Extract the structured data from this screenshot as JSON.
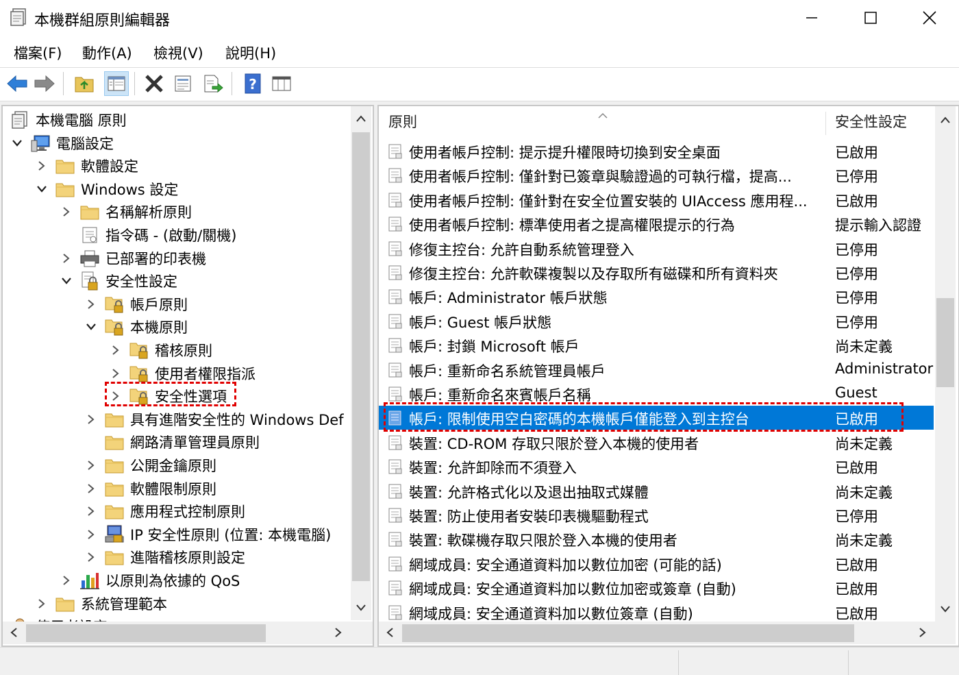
{
  "window": {
    "title": "本機群組原則編輯器"
  },
  "menu": [
    "檔案(F)",
    "動作(A)",
    "檢視(V)",
    "說明(H)"
  ],
  "toolbar": [
    "back-arrow-icon",
    "forward-arrow-icon",
    "up-folder-icon",
    "show-hide-tree-icon",
    "delete-icon",
    "properties-icon",
    "export-list-icon",
    "help-icon",
    "console-view-icon"
  ],
  "tree": [
    {
      "label": "本機電腦 原則",
      "level": 0,
      "chevron": "none",
      "icon": "policy-doc-icon"
    },
    {
      "label": "電腦設定",
      "level": 0,
      "chevron": "down",
      "icon": "computer-icon"
    },
    {
      "label": "軟體設定",
      "level": 1,
      "chevron": "right",
      "icon": "folder-icon"
    },
    {
      "label": "Windows 設定",
      "level": 1,
      "chevron": "down",
      "icon": "folder-icon"
    },
    {
      "label": "名稱解析原則",
      "level": 2,
      "chevron": "right",
      "icon": "folder-icon"
    },
    {
      "label": "指令碼 - (啟動/關機)",
      "level": 2,
      "chevron": "none",
      "icon": "script-icon"
    },
    {
      "label": "已部署的印表機",
      "level": 2,
      "chevron": "right",
      "icon": "printer-icon"
    },
    {
      "label": "安全性設定",
      "level": 2,
      "chevron": "down",
      "icon": "security-settings-icon"
    },
    {
      "label": "帳戶原則",
      "level": 3,
      "chevron": "right",
      "icon": "lock-folder-icon"
    },
    {
      "label": "本機原則",
      "level": 3,
      "chevron": "down",
      "icon": "lock-folder-icon"
    },
    {
      "label": "稽核原則",
      "level": 4,
      "chevron": "right",
      "icon": "lock-folder-icon"
    },
    {
      "label": "使用者權限指派",
      "level": 4,
      "chevron": "right",
      "icon": "lock-folder-icon"
    },
    {
      "label": "安全性選項",
      "level": 4,
      "chevron": "right",
      "icon": "lock-folder-icon"
    },
    {
      "label": "具有進階安全性的 Windows Def",
      "level": 3,
      "chevron": "right",
      "icon": "folder-icon"
    },
    {
      "label": "網路清單管理員原則",
      "level": 3,
      "chevron": "none",
      "icon": "folder-icon"
    },
    {
      "label": "公開金鑰原則",
      "level": 3,
      "chevron": "right",
      "icon": "folder-icon"
    },
    {
      "label": "軟體限制原則",
      "level": 3,
      "chevron": "right",
      "icon": "folder-icon"
    },
    {
      "label": "應用程式控制原則",
      "level": 3,
      "chevron": "right",
      "icon": "folder-icon"
    },
    {
      "label": "IP 安全性原則 (位置: 本機電腦)",
      "level": 3,
      "chevron": "right",
      "icon": "ip-security-icon"
    },
    {
      "label": "進階稽核原則設定",
      "level": 3,
      "chevron": "right",
      "icon": "folder-icon"
    },
    {
      "label": "以原則為依據的 QoS",
      "level": 2,
      "chevron": "right",
      "icon": "qos-chart-icon"
    },
    {
      "label": "系統管理範本",
      "level": 1,
      "chevron": "right",
      "icon": "folder-icon"
    },
    {
      "label": "使用者設定",
      "level": 0,
      "chevron": "none",
      "icon": "user-icon"
    }
  ],
  "list": {
    "col_policy": "原則",
    "col_setting": "安全性設定",
    "rows": [
      {
        "name": "使用者帳戶控制: 提示提升權限時切換到安全桌面",
        "value": "已啟用"
      },
      {
        "name": "使用者帳戶控制: 僅針對已簽章與驗證過的可執行檔，提高...",
        "value": "已停用"
      },
      {
        "name": "使用者帳戶控制: 僅針對在安全位置安裝的 UIAccess 應用程...",
        "value": "已啟用"
      },
      {
        "name": "使用者帳戶控制: 標準使用者之提高權限提示的行為",
        "value": "提示輸入認證"
      },
      {
        "name": "修復主控台: 允許自動系統管理登入",
        "value": "已停用"
      },
      {
        "name": "修復主控台: 允許軟碟複製以及存取所有磁碟和所有資料夾",
        "value": "已停用"
      },
      {
        "name": "帳戶: Administrator 帳戶狀態",
        "value": "已停用"
      },
      {
        "name": "帳戶: Guest 帳戶狀態",
        "value": "已停用"
      },
      {
        "name": "帳戶: 封鎖 Microsoft 帳戶",
        "value": "尚未定義"
      },
      {
        "name": "帳戶: 重新命名系統管理員帳戶",
        "value": "Administrator"
      },
      {
        "name": "帳戶: 重新命名來賓帳戶名稱",
        "value": "Guest"
      },
      {
        "name": "帳戶: 限制使用空白密碼的本機帳戶僅能登入到主控台",
        "value": "已啟用",
        "selected": true
      },
      {
        "name": "裝置: CD-ROM 存取只限於登入本機的使用者",
        "value": "尚未定義"
      },
      {
        "name": "裝置: 允許卸除而不須登入",
        "value": "已啟用"
      },
      {
        "name": "裝置: 允許格式化以及退出抽取式媒體",
        "value": "尚未定義"
      },
      {
        "name": "裝置: 防止使用者安裝印表機驅動程式",
        "value": "已停用"
      },
      {
        "name": "裝置: 軟碟機存取只限於登入本機的使用者",
        "value": "尚未定義"
      },
      {
        "name": "網域成員: 安全通道資料加以數位加密 (可能的話)",
        "value": "已啟用"
      },
      {
        "name": "網域成員: 安全通道資料加以數位加密或簽章 (自動)",
        "value": "已啟用"
      },
      {
        "name": "網域成員: 安全通道資料加以數位簽章 (自動)",
        "value": "已啟用"
      }
    ]
  },
  "colors": {
    "selection": "#0078d7",
    "highlight_box": "#e00000"
  }
}
